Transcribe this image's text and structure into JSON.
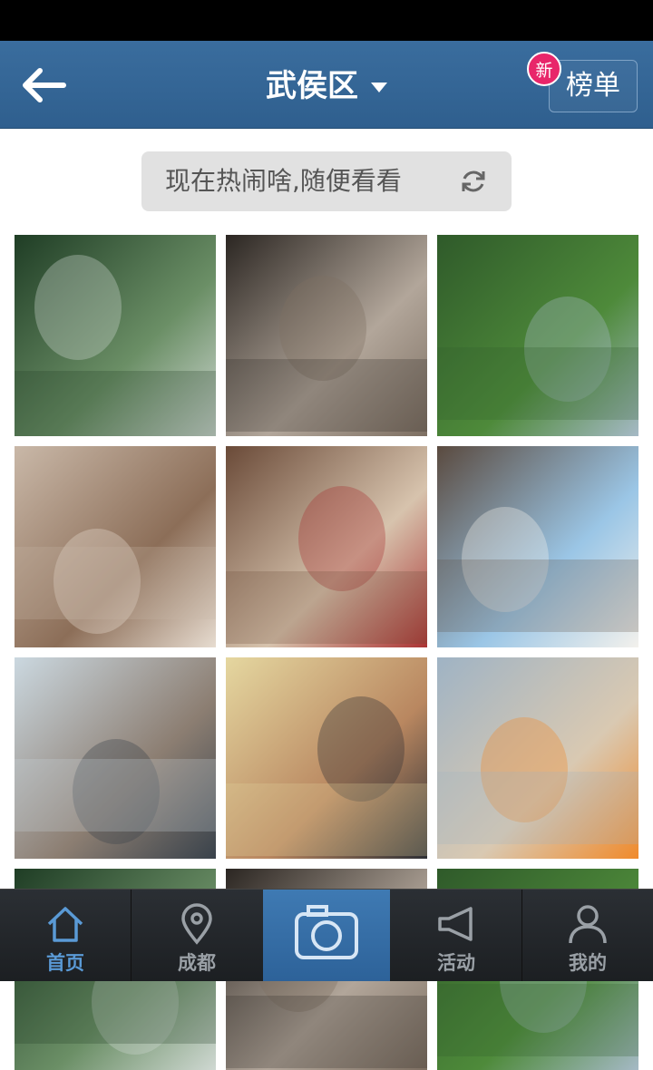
{
  "nav": {
    "title": "武侯区",
    "rank_label": "榜单",
    "new_badge": "新"
  },
  "random_button": {
    "label": "现在热闹啥,随便看看"
  },
  "photos": [
    {
      "palette": [
        "#1f3d25",
        "#6b8f66",
        "#cfd8d2"
      ]
    },
    {
      "palette": [
        "#2b2622",
        "#b2a69a",
        "#7d6f62"
      ]
    },
    {
      "palette": [
        "#2f5a2a",
        "#4e8a3a",
        "#a5b9c5"
      ]
    },
    {
      "palette": [
        "#c9b8a8",
        "#8c6e58",
        "#e7dcd0"
      ]
    },
    {
      "palette": [
        "#6a4a38",
        "#d7c3ad",
        "#a33"
      ]
    },
    {
      "palette": [
        "#5a4a3f",
        "#9bc6e6",
        "#f3f1ec"
      ]
    },
    {
      "palette": [
        "#cbd8e0",
        "#8c7e72",
        "#39424b"
      ]
    },
    {
      "palette": [
        "#e5d7a0",
        "#b98760",
        "#2d2f35"
      ]
    },
    {
      "palette": [
        "#9fb3c4",
        "#d9c9b2",
        "#f08a2b"
      ]
    }
  ],
  "tabs": [
    {
      "label": "首页",
      "icon": "home-icon",
      "active": true
    },
    {
      "label": "成都",
      "icon": "location-pin-icon",
      "active": false
    },
    {
      "label": "",
      "icon": "camera-icon",
      "active": false
    },
    {
      "label": "活动",
      "icon": "megaphone-icon",
      "active": false
    },
    {
      "label": "我的",
      "icon": "user-icon",
      "active": false
    }
  ],
  "colors": {
    "nav_bg": "#2f5f8e",
    "badge": "#e8266a",
    "tab_active": "#5a9ad6",
    "camera_tab_bg": "#3a74ad"
  }
}
